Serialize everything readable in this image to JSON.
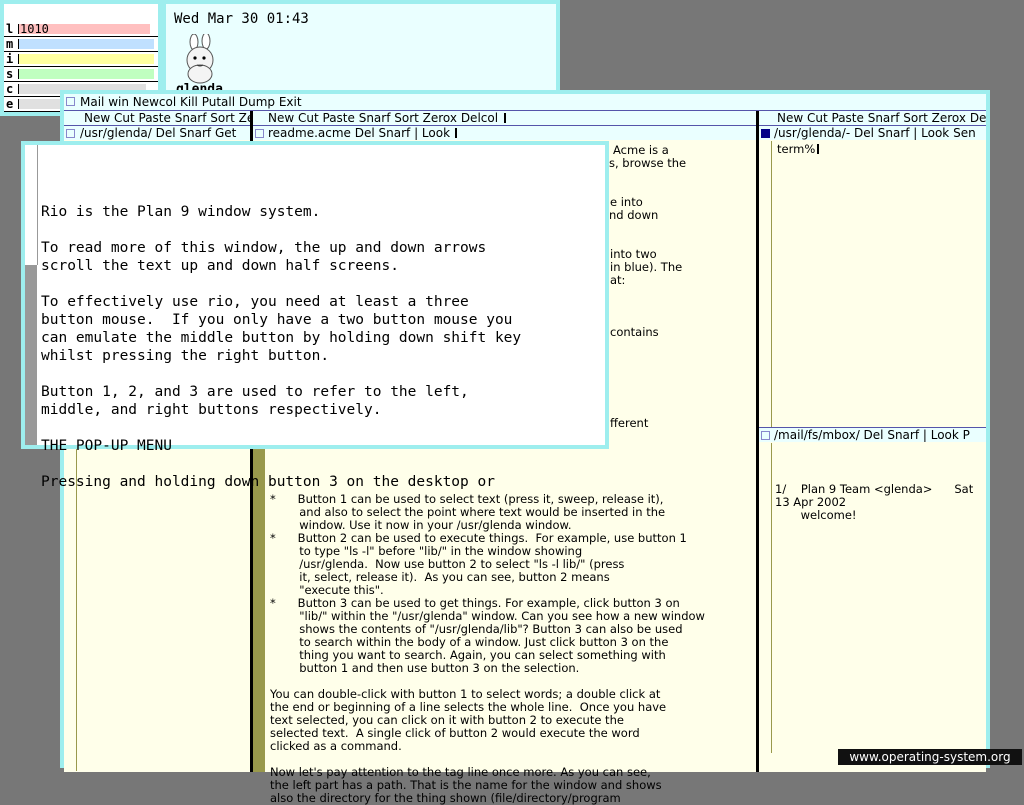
{
  "stats": {
    "labels": [
      "l",
      "m",
      "i",
      "s",
      "c",
      "e"
    ],
    "first_value": "1010"
  },
  "clock": {
    "datetime": "Wed Mar 30 01:43",
    "user": "glenda"
  },
  "acme": {
    "main_tag": "Mail win Newcol Kill Putall Dump Exit",
    "columns": [
      {
        "tag": "New Cut Paste Snarf Sort Zerox Delcol",
        "windows": [
          {
            "tag": "/usr/glenda/ Del Snarf Get"
          }
        ]
      },
      {
        "tag": "New Cut Paste Snarf Sort Zerox Delcol",
        "windows": [
          {
            "tag": "readme.acme Del Snarf | Look",
            "fragments": [
              "Acme is a",
              "s, browse the",
              "e into",
              "nd down",
              "into two",
              "in blue). The",
              "at:",
              "contains",
              "fferent"
            ],
            "lines": [
              "*      Button 1 can be used to select text (press it, sweep, release it),",
              "        and also to select the point where text would be inserted in the",
              "        window. Use it now in your /usr/glenda window.",
              "*      Button 2 can be used to execute things.  For example, use button 1",
              "        to type \"ls -l\" before \"lib/\" in the window showing",
              "        /usr/glenda.  Now use button 2 to select \"ls -l lib/\" (press",
              "        it, select, release it).  As you can see, button 2 means",
              "        \"execute this\".",
              "*      Button 3 can be used to get things. For example, click button 3 on",
              "        \"lib/\" within the \"/usr/glenda\" window. Can you see how a new window",
              "        shows the contents of \"/usr/glenda/lib\"? Button 3 can also be used",
              "        to search within the body of a window. Just click button 3 on the",
              "        thing you want to search. Again, you can select something with",
              "        button 1 and then use button 3 on the selection.",
              "",
              "You can double-click with button 1 to select words; a double click at",
              "the end or beginning of a line selects the whole line.  Once you have",
              "text selected, you can click on it with button 2 to execute the",
              "selected text.  A single click of button 2 would execute the word",
              "clicked as a command.",
              "",
              "Now let's pay attention to the tag line once more. As you can see,",
              "the left part has a path. That is the name for the window and shows",
              "also the directory for the thing shown (file/directory/program"
            ]
          }
        ]
      },
      {
        "tag": "New Cut Paste Snarf Sort Zerox De",
        "windows": [
          {
            "tag": "/usr/glenda/- Del Snarf | Look Sen",
            "body": "term%"
          },
          {
            "tag": "/mail/fs/mbox/ Del Snarf | Look P",
            "body_lines": [
              "1/    Plan 9 Team <glenda>      Sat",
              "13 Apr 2002",
              "       welcome!"
            ]
          }
        ]
      }
    ]
  },
  "rio_window": {
    "lines": [
      "Rio is the Plan 9 window system.",
      "",
      "To read more of this window, the up and down arrows",
      "scroll the text up and down half screens.",
      "",
      "To effectively use rio, you need at least a three",
      "button mouse.  If you only have a two button mouse you",
      "can emulate the middle button by holding down shift key",
      "whilst pressing the right button.",
      "",
      "Button 1, 2, and 3 are used to refer to the left,",
      "middle, and right buttons respectively.",
      "",
      "THE POP-UP MENU",
      "",
      "Pressing and holding down button 3 on the desktop or"
    ]
  },
  "watermark": "www.operating-system.org",
  "colors": {
    "desktop": "#777777",
    "border": "#9eeeee",
    "tag_bg": "#eaffff",
    "body_bg": "#ffffea",
    "scrollbar": "#99994c"
  },
  "icons": [
    "glenda-bunny-icon"
  ]
}
